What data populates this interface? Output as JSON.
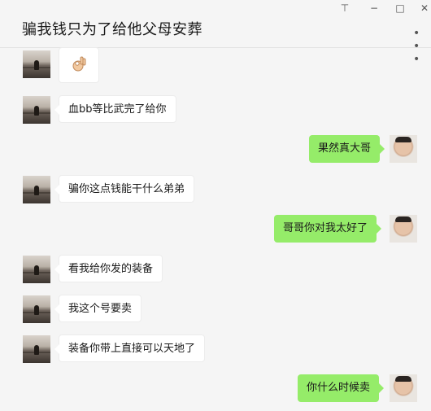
{
  "chat_title": "骗我钱只为了给他父母安葬",
  "window_controls": {
    "pin": "⊤",
    "minimize": "−",
    "maximize": "□",
    "close": "✕"
  },
  "more_label": "• • •",
  "messages": [
    {
      "side": "left",
      "type": "emoji",
      "icon": "ok-hand-icon"
    },
    {
      "side": "left",
      "type": "text",
      "text": "血bb等比武完了给你"
    },
    {
      "side": "right",
      "type": "text",
      "text": "果然真大哥"
    },
    {
      "side": "left",
      "type": "text",
      "text": "骗你这点钱能干什么弟弟"
    },
    {
      "side": "right",
      "type": "text",
      "text": "哥哥你对我太好了"
    },
    {
      "side": "left",
      "type": "text",
      "text": "看我给你发的装备"
    },
    {
      "side": "left",
      "type": "text",
      "text": "我这个号要卖"
    },
    {
      "side": "left",
      "type": "text",
      "text": "装备你带上直接可以天地了"
    },
    {
      "side": "right",
      "type": "text",
      "text": "你什么时候卖"
    }
  ],
  "colors": {
    "background": "#f5f5f5",
    "bubble_self": "#95ec69",
    "bubble_other": "#ffffff"
  }
}
